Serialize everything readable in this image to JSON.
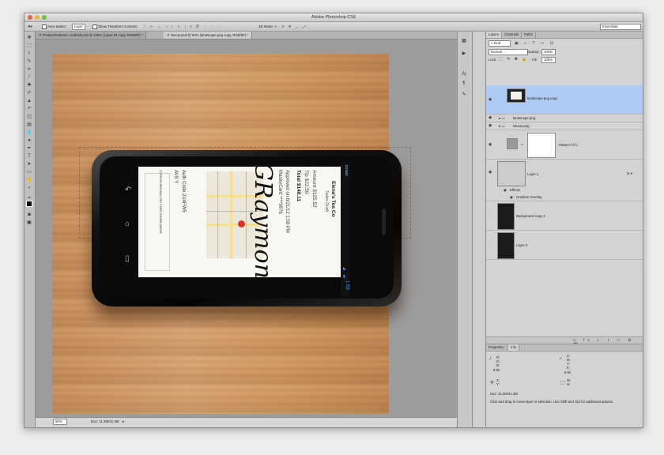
{
  "app": {
    "title": "Adobe Photoshop CS6"
  },
  "options": {
    "auto_select": "Auto-Select:",
    "auto_select_value": "Layer",
    "show_transform": "Show Transform Controls",
    "mode_3d": "3D Mode:",
    "workspace": "Essentials"
  },
  "doc_tabs": [
    {
      "label": "ProductFeatures--Android.psd @ 100% (Layer 84 copy, RGB/8#) *"
    },
    {
      "label": "Nexus.psd @ 50% (landscape.png copy, RGB/8#) *"
    }
  ],
  "status": {
    "zoom": "50%",
    "doc": "Doc: 11.3M/41.3M"
  },
  "receipt": {
    "merchant": "Elena's Tea Co",
    "type": "Sales Draft",
    "amount": "Amount  $125.52",
    "tip": "Tip     $22.59",
    "total": "Total  $148.11",
    "approved": "Approved on 6/21/12 1:58 PM",
    "card": "MasterCard ****9876",
    "auth": "Auth Code 2U4FW5",
    "avs": "AVS  Y",
    "cardholder": "CARDHOLDER WILL PAY CARD ISSUER ABOVE",
    "signature": "GRaymond",
    "details": "Details",
    "time": "1:59"
  },
  "layers_panel": {
    "tabs": [
      "Layers",
      "Channels",
      "Paths"
    ],
    "kind": "Kind",
    "blend": "Normal",
    "opacity_label": "Opacity:",
    "opacity": "100%",
    "lock_label": "Lock:",
    "fill_label": "Fill:",
    "fill": "100%",
    "layers": [
      {
        "name": "landscape.png copy"
      },
      {
        "name": "landscape.png"
      },
      {
        "name": "Nexus.png"
      },
      {
        "name": "Pattern Fill 1"
      },
      {
        "name": "Layer 1"
      },
      {
        "name": "Effects"
      },
      {
        "name": "Gradient Overlay"
      },
      {
        "name": "Background copy 2"
      },
      {
        "name": "Layer 0"
      }
    ]
  },
  "info_panel": {
    "tabs": [
      "Properties",
      "Info"
    ],
    "rgb": "R:\nG:\nB:",
    "bits1": "8-bit",
    "cmyk": "C:\nM:\nY:\nK:",
    "bits2": "8-bit",
    "xy": "X:\nY:",
    "wh": "W:\nH:",
    "doc": "Doc: 11.3M/41.3M",
    "hint": "Click and drag to move layer or selection.  Use Shift and Opt for additional options."
  }
}
